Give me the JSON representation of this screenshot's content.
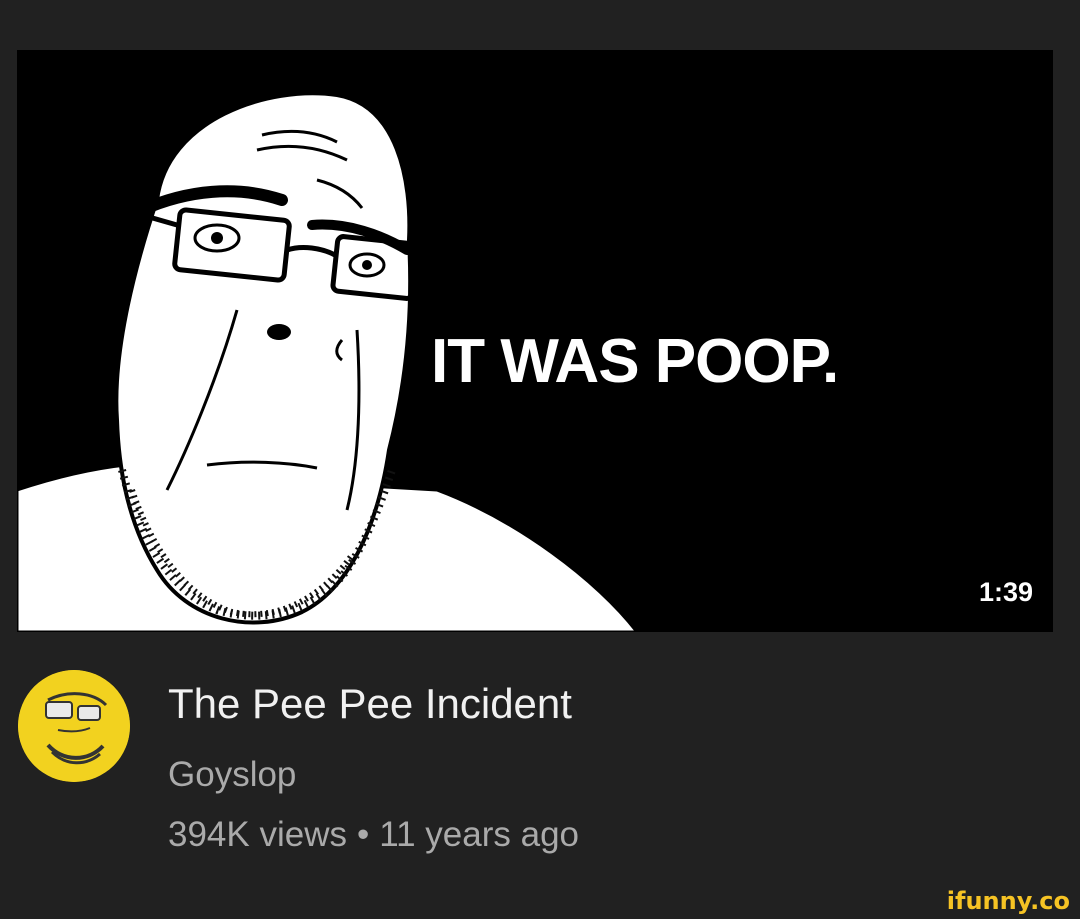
{
  "video": {
    "thumbnail_text": "IT WAS POOP.",
    "duration": "1:39",
    "title": "The Pee Pee Incident",
    "channel": "Goyslop",
    "views": "394K views",
    "separator": "•",
    "age": "11 years ago"
  },
  "watermark": "ifunny.co",
  "colors": {
    "background": "#212121",
    "title": "#f1f1f1",
    "secondary_text": "#aaaaaa",
    "avatar": "#f2d21f",
    "watermark": "#f6c324"
  },
  "icons": {
    "thumbnail_figure": "wojak-soyjak-glasses-face",
    "avatar": "yellow-wojak-face-icon"
  }
}
